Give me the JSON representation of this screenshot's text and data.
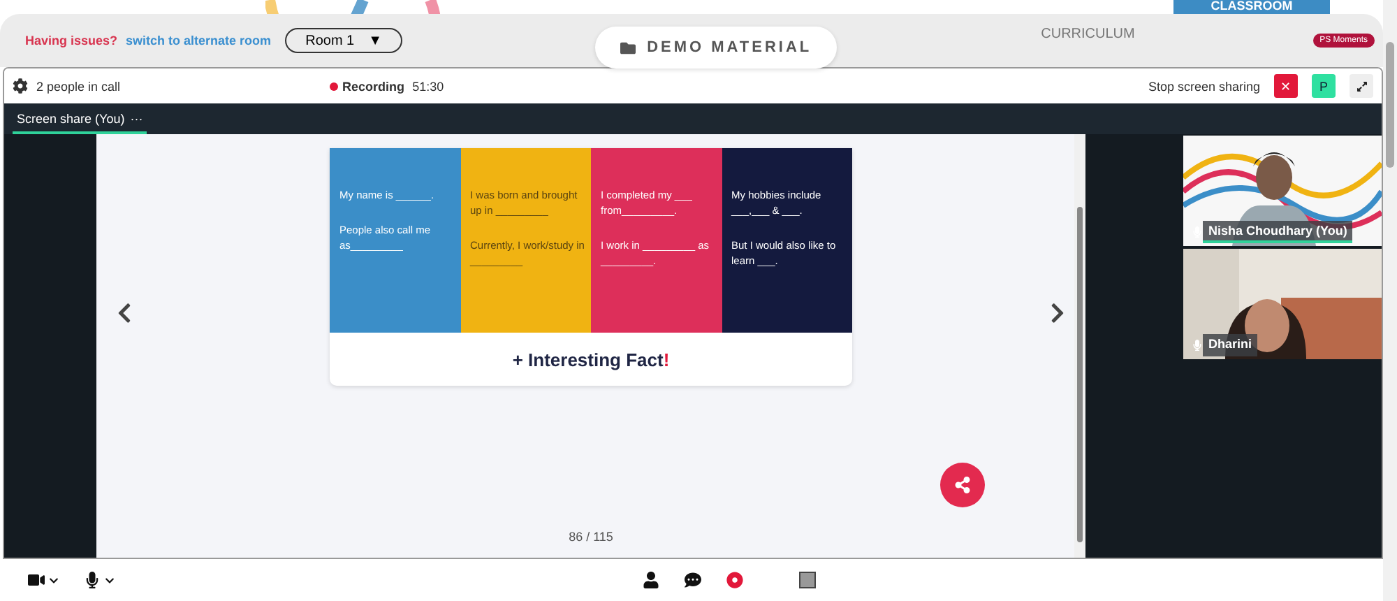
{
  "header": {
    "issue_label": "Having issues?",
    "switch_link": "switch to alternate room",
    "room_select": "Room 1",
    "room_caret": "▼",
    "demo_button": "DEMO MATERIAL",
    "curriculum_tab": "CURRICULUM",
    "classroom_tab": "CLASSROOM",
    "moments_badge": "PS Moments"
  },
  "toolbar": {
    "people": "2 people in call",
    "recording_label": "Recording",
    "recording_time": "51:30",
    "stop_share": "Stop screen sharing",
    "stop_icon": "✕",
    "avatar": "P"
  },
  "share_tab": {
    "label": "Screen share (You)",
    "more": "···",
    "selected": true
  },
  "slide": {
    "columns": [
      {
        "color": "#3b8ec8",
        "lines": [
          "My name is ______.",
          "People also call me as_________"
        ]
      },
      {
        "color": "#f0b312",
        "lines": [
          "I was born and brought up in _________",
          "Currently, I work/study in _________"
        ]
      },
      {
        "color": "#dd2f5a",
        "lines": [
          "I completed my ___ from_________.",
          "I work in _________ as _________."
        ]
      },
      {
        "color": "#141a3e",
        "lines": [
          "My hobbies include ___,___ & ___.",
          "But I would also like to learn ___."
        ]
      }
    ],
    "caption": "+ Interesting Fact",
    "caption_mark": "!",
    "page": "86 / 115"
  },
  "videos": [
    {
      "name": "Nisha Choudhary (You)",
      "speaking": true
    },
    {
      "name": "Dharini",
      "speaking": false
    }
  ]
}
